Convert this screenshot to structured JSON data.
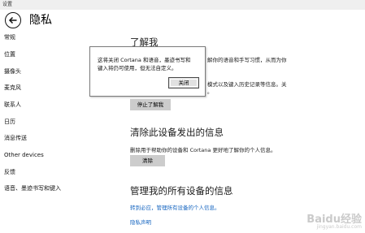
{
  "window": {
    "title": "设置"
  },
  "header": {
    "back_label": "back",
    "title": "隐私"
  },
  "sidebar": {
    "items": [
      {
        "label": "常规"
      },
      {
        "label": "位置"
      },
      {
        "label": "摄像头"
      },
      {
        "label": "麦克风"
      },
      {
        "label": "联系人"
      },
      {
        "label": "日历"
      },
      {
        "label": "消息传送"
      },
      {
        "label": "Other devices"
      },
      {
        "label": "反馈"
      },
      {
        "label": "语音、墨迹书写和键入"
      }
    ]
  },
  "main": {
    "section1": {
      "heading": "了解我",
      "text_line1": "解你的语音和手写习惯，从而为你",
      "text_line2": "模式以及键入历史记录等信息。关",
      "text_line3": "。",
      "button": "停止了解我"
    },
    "section2": {
      "heading": "清除此设备发出的信息",
      "text": "删除用于帮助你的设备和 Cortana 更好地了解你的个人信息。",
      "button": "清除"
    },
    "section3": {
      "heading": "管理我的所有设备的信息",
      "link1": "转到必应，管理所有设备的个人信息。",
      "link2": "隐私声明"
    }
  },
  "dialog": {
    "line1": "这将关闭 Cortana 和语音，墨迹书写和",
    "line2": "键入将仍可使用，但无法自定义。",
    "close_button": "关闭"
  },
  "watermark": {
    "text": "Baidu经验",
    "sub": "jingyan.baidu.com"
  }
}
